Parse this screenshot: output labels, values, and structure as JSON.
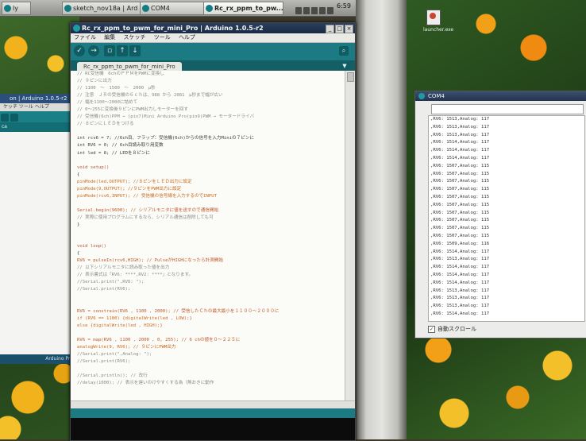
{
  "taskbar": {
    "buttons": [
      "ly",
      "sketch_nov18a | Ard",
      "COM4",
      "Rc_rx_ppm_to_pw..."
    ],
    "clock": "6:59"
  },
  "back_window": {
    "title": "on | Arduino 1.0.5-r2",
    "menu": "ケッチ  ツール  ヘルプ",
    "footer": "Arduino Pro or"
  },
  "main_window": {
    "title": "Rc_rx_ppm_to_pwm_for_mini_Pro | Arduino 1.0.5-r2",
    "menu": [
      "ファイル",
      "編集",
      "スケッチ",
      "ツール",
      "ヘルプ"
    ],
    "tab_label": "Rc_rx_ppm_to_pwm_for_mini_Pro",
    "code": [
      {
        "t": "// RC受信機　6chのＰＰＭをPWMに変換し",
        "c": "comment"
      },
      {
        "t": "// ９ピンに出力",
        "c": "comment"
      },
      {
        "t": "// 1100　～　1500　～　2000　μ秒",
        "c": "comment"
      },
      {
        "t": "// 注意　ＪＲの受信機の６ｃｈは、988 から 2081　μ秒まで幅が広い",
        "c": "comment"
      },
      {
        "t": "// 幅を1100～2000に詰めて",
        "c": "comment"
      },
      {
        "t": "// 0～255に変換後９ピンにPWM出力しモーターを回す",
        "c": "comment"
      },
      {
        "t": "// 受信機(6ch)PPM → (pin7)Mini Arduino Pro(pin9)PWM → モータードライバ",
        "c": "comment"
      },
      {
        "t": "// ８ピンにＬＥＤをつける",
        "c": "comment"
      },
      {
        "t": "",
        "c": ""
      },
      {
        "t": "int rcv6 = 7; //6ch目、フラップ：受信機(6ch)からの信号を入力Miniの７ピンに",
        "c": ""
      },
      {
        "t": "int RV6 = 0; // 6ch目読み取り用変数",
        "c": ""
      },
      {
        "t": "int led = 8; // LEDを８ピンに",
        "c": ""
      },
      {
        "t": "",
        "c": ""
      },
      {
        "t": "void setup()",
        "c": "kw"
      },
      {
        "t": "{",
        "c": ""
      },
      {
        "t": "pinMode(led,OUTPUT); //８ピンをＬＥＤ出力に設定",
        "c": "fn"
      },
      {
        "t": "pinMode(9,OUTPUT); //９ピンをPWM出力に設定",
        "c": "fn"
      },
      {
        "t": "pinMode(rcv6,INPUT); // 受信機の信号線を入力するのでINPUT",
        "c": "fn"
      },
      {
        "t": "",
        "c": ""
      },
      {
        "t": "Serial.begin(9600); // シリアルモニタに値を送すので通信開始",
        "c": "call"
      },
      {
        "t": "// 実際に使用プログラムにするなら、シリアル通信は削除しても可",
        "c": "comment"
      },
      {
        "t": "}",
        "c": ""
      },
      {
        "t": "",
        "c": ""
      },
      {
        "t": "",
        "c": ""
      },
      {
        "t": "void loop()",
        "c": "kw"
      },
      {
        "t": "{",
        "c": ""
      },
      {
        "t": "RV6 = pulseIn(rcv6,HIGH); // PulseがHIGHになったら計測開始",
        "c": "call"
      },
      {
        "t": "// 以下シリアルモニタに読み取った値を出力",
        "c": "comment"
      },
      {
        "t": "// 表示書式は「RV6: ****,RV2: ****」となります。",
        "c": "comment"
      },
      {
        "t": "//Serial.print(\",RV6: \");",
        "c": "comment"
      },
      {
        "t": "//Serial.print(RV6);",
        "c": "comment"
      },
      {
        "t": "",
        "c": ""
      },
      {
        "t": "",
        "c": ""
      },
      {
        "t": "RV6 = constrain(RV6 , 1100 , 2000); // 受信したＣｈの最大最小を１１００～２０００に",
        "c": "call"
      },
      {
        "t": "if (RV6 == 1100) {digitalWrite(led , LOW);}",
        "c": "fn"
      },
      {
        "t": "else {digitalWrite(led , HIGH);}",
        "c": "fn"
      },
      {
        "t": "",
        "c": ""
      },
      {
        "t": "RV6 = map(RV6 , 1100 , 2000 , 0, 255); // 6 chの値を０～２２５に",
        "c": "call"
      },
      {
        "t": "analogWrite(9, RV6); // ９ピンにPWM出力",
        "c": "fn"
      },
      {
        "t": "//Serial.print(\",Analog: \");",
        "c": "comment"
      },
      {
        "t": "//Serial.print(RV6);",
        "c": "comment"
      },
      {
        "t": "",
        "c": ""
      },
      {
        "t": "//Serial.println(); // 改行",
        "c": "comment"
      },
      {
        "t": "//delay(1000); // 表示を遅いのけやすくする為（無おきに動作",
        "c": "comment"
      }
    ]
  },
  "serial_monitor": {
    "title": "COM4",
    "lines": [
      ",RV6: 1513,Analog: 117",
      ",RV6: 1513,Analog: 117",
      ",RV6: 1513,Analog: 117",
      ",RV6: 1514,Analog: 117",
      ",RV6: 1514,Analog: 117",
      ",RV6: 1514,Analog: 117",
      ",RV6: 1507,Analog: 115",
      ",RV6: 1507,Analog: 115",
      ",RV6: 1507,Analog: 115",
      ",RV6: 1507,Analog: 115",
      ",RV6: 1507,Analog: 115",
      ",RV6: 1507,Analog: 115",
      ",RV6: 1507,Analog: 115",
      ",RV6: 1507,Analog: 115",
      ",RV6: 1507,Analog: 115",
      ",RV6: 1507,Analog: 115",
      ",RV6: 1509,Analog: 116",
      ",RV6: 1514,Analog: 117",
      ",RV6: 1513,Analog: 117",
      ",RV6: 1514,Analog: 117",
      ",RV6: 1514,Analog: 117",
      ",RV6: 1514,Analog: 117",
      ",RV6: 1513,Analog: 117",
      ",RV6: 1513,Analog: 117",
      ",RV6: 1513,Analog: 117",
      ",RV6: 1514,Analog: 117"
    ],
    "autoscroll_label": "自動スクロール"
  },
  "desktop": {
    "launcher_label": "launcher.exe"
  },
  "colors": {
    "arduino_teal": "#1c7b82",
    "title_bar": "#1a2a44",
    "comment": "#8a8a86",
    "keyword": "#b3563a"
  }
}
